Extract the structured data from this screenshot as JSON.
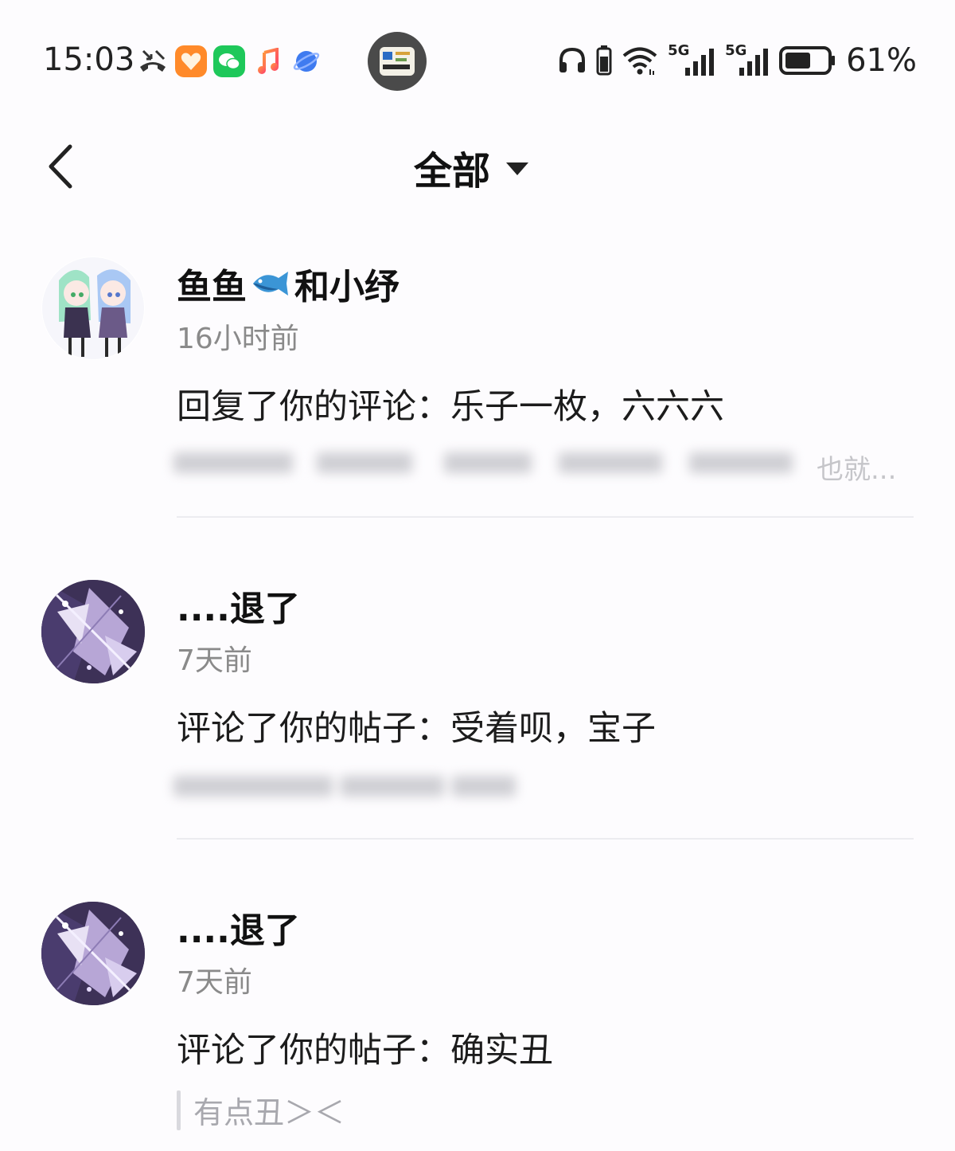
{
  "status_bar": {
    "time": "15:03",
    "battery_percent": "61%",
    "network_a": "5G",
    "network_b": "5G",
    "icons": [
      "missed-call-icon",
      "orange-app-icon",
      "wechat-icon",
      "music-icon",
      "browser-icon",
      "floating-window-icon",
      "headphones-icon",
      "battery-small-icon",
      "wifi-icon",
      "signal-icon",
      "signal-icon",
      "battery-icon"
    ],
    "battery_level": 0.61
  },
  "header": {
    "title": "全部"
  },
  "notifications": [
    {
      "user": "鱼鱼",
      "user_suffix": "和小纾",
      "time": "16小时前",
      "text": "回复了你的评论：乐子一枚，六六六",
      "quote_fragment": "也就..."
    },
    {
      "user": "....退了",
      "time": "7天前",
      "text": "评论了你的帖子：受着呗，宝子"
    },
    {
      "user": "....退了",
      "time": "7天前",
      "text": "评论了你的帖子：确实丑",
      "quote": "有点丑＞＜"
    }
  ],
  "colors": {
    "background": "#fdfcfe",
    "name_text": "#111111",
    "time_text": "#8a8a8a",
    "quote_text": "#a8a8ae",
    "divider": "#ececf0",
    "wechat_green": "#1ec85a",
    "orange_app": "#ff8a2a"
  }
}
